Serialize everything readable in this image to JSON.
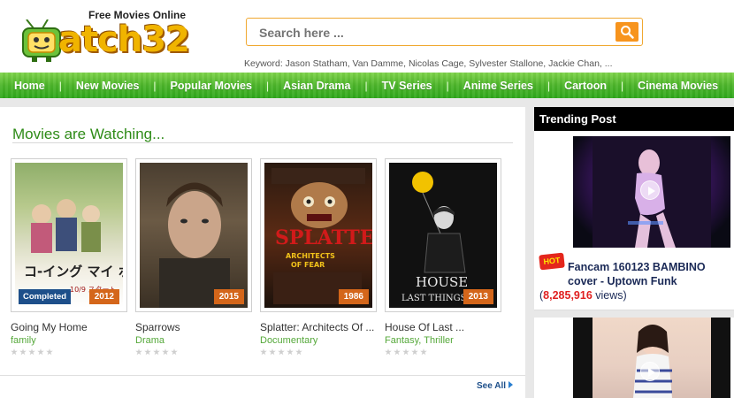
{
  "header": {
    "tagline": "Free Movies Online",
    "logo_text": "atch32",
    "search_placeholder": "Search here ...",
    "keywords": "Keyword: Jason Statham, Van Damme, Nicolas Cage, Sylvester Stallone, Jackie Chan, ..."
  },
  "nav": {
    "items": [
      "Home",
      "New Movies",
      "Popular Movies",
      "Asian Drama",
      "TV Series",
      "Anime Series",
      "Cartoon",
      "Cinema Movies"
    ],
    "separator": "|"
  },
  "main": {
    "section_title": "Movies are Watching...",
    "see_all": "See All",
    "movies": [
      {
        "title": "Going My Home",
        "genre": "family",
        "year": "2012",
        "status": "Completed"
      },
      {
        "title": "Sparrows",
        "genre": "Drama",
        "year": "2015"
      },
      {
        "title": "Splatter: Architects Of ...",
        "genre": "Documentary",
        "year": "1986"
      },
      {
        "title": "House Of Last ...",
        "genre": "Fantasy, Thriller",
        "year": "2013"
      }
    ]
  },
  "sidebar": {
    "title": "Trending Post",
    "hot_badge": "HOT",
    "post_title": "Fancam 160123 BAMBINO cover - Uptown Funk",
    "post_views_prefix": "(",
    "post_views": "8,285,916",
    "post_views_suffix": "views)"
  },
  "colors": {
    "nav_green": "#4cb52a",
    "section_title_green": "#2e8b17",
    "search_button_orange": "#f7941d",
    "year_badge": "#d4661a",
    "status_badge": "#1d4f8a",
    "views_red": "#e02020"
  },
  "icons": {
    "search": "magnifier-icon",
    "play": "play-icon",
    "see_all_arrow": "triangle-right-icon"
  }
}
